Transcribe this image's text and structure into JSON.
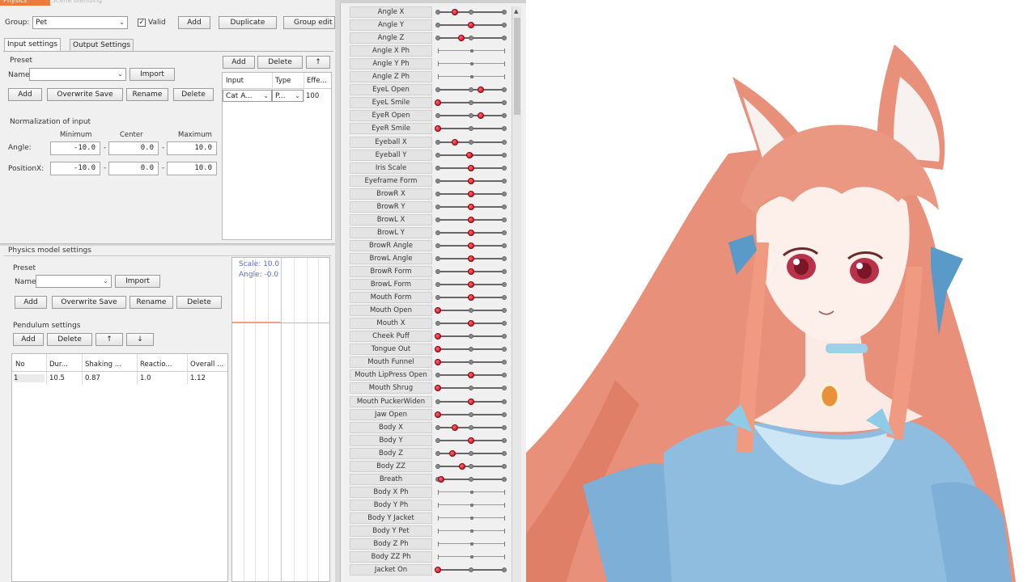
{
  "window": {
    "title_tabs": [
      "Physics",
      "Scene Blending"
    ]
  },
  "group": {
    "label": "Group:",
    "value": "Pet",
    "valid_label": "Valid",
    "valid_checked": true,
    "add_label": "Add",
    "duplicate_label": "Duplicate",
    "group_edit_label": "Group edit"
  },
  "tabs": {
    "input_settings": "Input settings",
    "output_settings": "Output Settings"
  },
  "input_preset": {
    "section": "Preset",
    "name_label": "Name:",
    "import_label": "Import",
    "add_label": "Add",
    "overwrite_label": "Overwrite Save",
    "rename_label": "Rename",
    "delete_label": "Delete"
  },
  "input_table": {
    "add_label": "Add",
    "delete_label": "Delete",
    "up_label": "↑",
    "headers": [
      "Input",
      "Type",
      "Effe..."
    ],
    "row": [
      "Cat A...",
      "P...",
      "100"
    ]
  },
  "normalization": {
    "title": "Normalization of input",
    "col_min": "Minimum",
    "col_center": "Center",
    "col_max": "Maximum",
    "rows": [
      {
        "label": "Angle:",
        "min": "-10.0",
        "center": "0.0",
        "max": "10.0"
      },
      {
        "label": "PositionX:",
        "min": "-10.0",
        "center": "0.0",
        "max": "10.0"
      }
    ]
  },
  "physics_model": {
    "title": "Physics model settings",
    "preset_section": "Preset",
    "name_label": "Name:",
    "import_label": "Import",
    "add_label": "Add",
    "overwrite_label": "Overwrite Save",
    "rename_label": "Rename",
    "delete_label": "Delete",
    "pendulum_title": "Pendulum settings",
    "pend_add": "Add",
    "pend_delete": "Delete",
    "pend_up": "↑",
    "pend_down": "↓",
    "headers": [
      "No",
      "Dur...",
      "Shaking ...",
      "Reactio...",
      "Overall ..."
    ],
    "row": [
      "1",
      "10.5",
      "0.87",
      "1.0",
      "1.12"
    ]
  },
  "preview": {
    "scale": "Scale: 10.0",
    "angle": "Angle: -0.0"
  },
  "parameters": [
    {
      "name": "Angle X",
      "value": 0.25
    },
    {
      "name": "Angle Y",
      "value": 0.5
    },
    {
      "name": "Angle Z",
      "value": 0.35
    },
    {
      "name": "Angle X Ph",
      "value": null
    },
    {
      "name": "Angle Y Ph",
      "value": null
    },
    {
      "name": "Angle Z Ph",
      "value": null
    },
    {
      "name": "EyeL Open",
      "value": 0.65
    },
    {
      "name": "EyeL Smile",
      "value": 0.0
    },
    {
      "name": "EyeR Open",
      "value": 0.65
    },
    {
      "name": "EyeR Smile",
      "value": 0.0
    },
    {
      "name": "Eyeball X",
      "value": 0.25
    },
    {
      "name": "Eyeball Y",
      "value": 0.48
    },
    {
      "name": "Iris Scale",
      "value": 0.5
    },
    {
      "name": "Eyeframe Form",
      "value": 0.5
    },
    {
      "name": "BrowR X",
      "value": 0.5
    },
    {
      "name": "BrowR Y",
      "value": 0.5
    },
    {
      "name": "BrowL X",
      "value": 0.5
    },
    {
      "name": "BrowL Y",
      "value": 0.5
    },
    {
      "name": "BrowR Angle",
      "value": 0.5
    },
    {
      "name": "BrowL Angle",
      "value": 0.5
    },
    {
      "name": "BrowR Form",
      "value": 0.5
    },
    {
      "name": "BrowL Form",
      "value": 0.5
    },
    {
      "name": "Mouth Form",
      "value": 0.5
    },
    {
      "name": "Mouth Open",
      "value": 0.0
    },
    {
      "name": "Mouth X",
      "value": 0.5
    },
    {
      "name": "Cheek Puff",
      "value": 0.0
    },
    {
      "name": "Tongue Out",
      "value": 0.0
    },
    {
      "name": "Mouth Funnel",
      "value": 0.0
    },
    {
      "name": "Mouth LipPress Open",
      "value": 0.5
    },
    {
      "name": "Mouth Shrug",
      "value": 0.0
    },
    {
      "name": "Mouth PuckerWiden",
      "value": 0.5
    },
    {
      "name": "Jaw Open",
      "value": 0.0
    },
    {
      "name": "Body X",
      "value": 0.25
    },
    {
      "name": "Body Y",
      "value": 0.5
    },
    {
      "name": "Body Z",
      "value": 0.22
    },
    {
      "name": "Body ZZ",
      "value": 0.36
    },
    {
      "name": "Breath",
      "value": 0.05
    },
    {
      "name": "Body X Ph",
      "value": null
    },
    {
      "name": "Body Y Ph",
      "value": null
    },
    {
      "name": "Body Y Jacket",
      "value": null
    },
    {
      "name": "Body Y Pet",
      "value": null
    },
    {
      "name": "Body Z Ph",
      "value": null
    },
    {
      "name": "Body ZZ Ph",
      "value": null
    },
    {
      "name": "Jacket On",
      "value": 0.0
    }
  ],
  "colors": {
    "knob": "#d0021b",
    "title_tab": "#f07a3a",
    "hair": "#e8907a",
    "dress": "#8fbde0"
  }
}
